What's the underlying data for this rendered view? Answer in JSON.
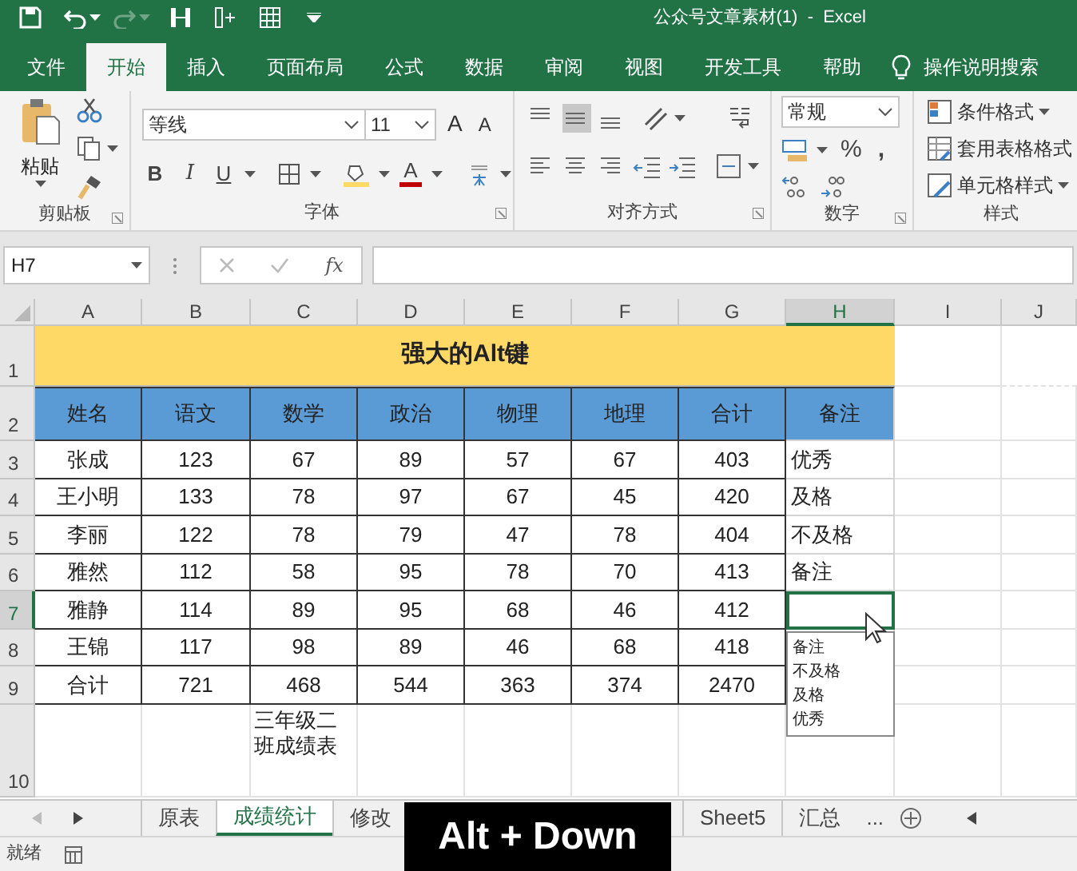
{
  "title_bar": {
    "title": "公众号文章素材(1)  -  Excel"
  },
  "ribbon_tabs": [
    {
      "label": "文件",
      "selected": false
    },
    {
      "label": "开始",
      "selected": true
    },
    {
      "label": "插入",
      "selected": false
    },
    {
      "label": "页面布局",
      "selected": false
    },
    {
      "label": "公式",
      "selected": false
    },
    {
      "label": "数据",
      "selected": false
    },
    {
      "label": "审阅",
      "selected": false
    },
    {
      "label": "视图",
      "selected": false
    },
    {
      "label": "开发工具",
      "selected": false
    },
    {
      "label": "帮助",
      "selected": false
    }
  ],
  "tell_me": {
    "placeholder": "操作说明搜索"
  },
  "clipboard": {
    "paste_label": "粘贴",
    "group_label": "剪贴板"
  },
  "font": {
    "font_name": "等线",
    "font_size": "11",
    "grow_label": "A",
    "shrink_label": "A",
    "bold_label": "B",
    "italic_label": "I",
    "underline_label": "U",
    "font_color_label": "A",
    "group_label": "字体"
  },
  "alignment": {
    "vertical_align": [
      {
        "selected": false
      },
      {
        "selected": true
      },
      {
        "selected": false
      }
    ],
    "group_label": "对齐方式"
  },
  "number": {
    "format": "常规",
    "percent_label": "%",
    "comma_label": ",",
    "group_label": "数字"
  },
  "styles": {
    "items": [
      "条件格式",
      "套用表格格式",
      "单元格样式"
    ],
    "group_label": "样式"
  },
  "formula_bar": {
    "name_box": "H7",
    "fx_label": "fx"
  },
  "columns": [
    {
      "label": "A",
      "selected": false
    },
    {
      "label": "B",
      "selected": false
    },
    {
      "label": "C",
      "selected": false
    },
    {
      "label": "D",
      "selected": false
    },
    {
      "label": "E",
      "selected": false
    },
    {
      "label": "F",
      "selected": false
    },
    {
      "label": "G",
      "selected": false
    },
    {
      "label": "H",
      "selected": true
    },
    {
      "label": "I",
      "selected": false
    },
    {
      "label": "J",
      "selected": false
    }
  ],
  "row_headers": [
    {
      "label": "1",
      "selected": false
    },
    {
      "label": "2",
      "selected": false
    },
    {
      "label": "3",
      "selected": false
    },
    {
      "label": "4",
      "selected": false
    },
    {
      "label": "5",
      "selected": false
    },
    {
      "label": "6",
      "selected": false
    },
    {
      "label": "7",
      "selected": true
    },
    {
      "label": "8",
      "selected": false
    },
    {
      "label": "9",
      "selected": false
    },
    {
      "label": "10",
      "selected": false
    }
  ],
  "sheet": {
    "title": "强大的Alt键",
    "header": [
      "姓名",
      "语文",
      "数学",
      "政治",
      "物理",
      "地理",
      "合计",
      "备注"
    ],
    "rows": [
      {
        "cells": [
          "张成",
          "123",
          "67",
          "89",
          "57",
          "67",
          "403",
          "优秀"
        ],
        "active": false
      },
      {
        "cells": [
          "王小明",
          "133",
          "78",
          "97",
          "67",
          "45",
          "420",
          "及格"
        ],
        "active": false
      },
      {
        "cells": [
          "李丽",
          "122",
          "78",
          "79",
          "47",
          "78",
          "404",
          "不及格"
        ],
        "active": false
      },
      {
        "cells": [
          "雅然",
          "112",
          "58",
          "95",
          "78",
          "70",
          "413",
          "备注"
        ],
        "active": false
      },
      {
        "cells": [
          "雅静",
          "114",
          "89",
          "95",
          "68",
          "46",
          "412"
        ],
        "active": true
      },
      {
        "cells": [
          "王锦",
          "117",
          "98",
          "89",
          "46",
          "68",
          "418"
        ],
        "active": false
      },
      {
        "cells": [
          "合计",
          "721",
          "468",
          "544",
          "363",
          "374",
          "2470"
        ],
        "active": false
      }
    ],
    "note": "三年级二班成绩表"
  },
  "dropdown_list": {
    "items": [
      "备注",
      "不及格",
      "及格",
      "优秀"
    ]
  },
  "sheet_tabs": [
    {
      "label": "原表",
      "selected": false
    },
    {
      "label": "成绩统计",
      "selected": true
    },
    {
      "label": "修改",
      "selected": false
    },
    {
      "label": "Sheet5",
      "selected": false
    },
    {
      "label": "汇总",
      "selected": false
    }
  ],
  "more_tabs": "...",
  "status_bar": {
    "status": "就绪"
  },
  "key_overlay": "Alt + Down"
}
